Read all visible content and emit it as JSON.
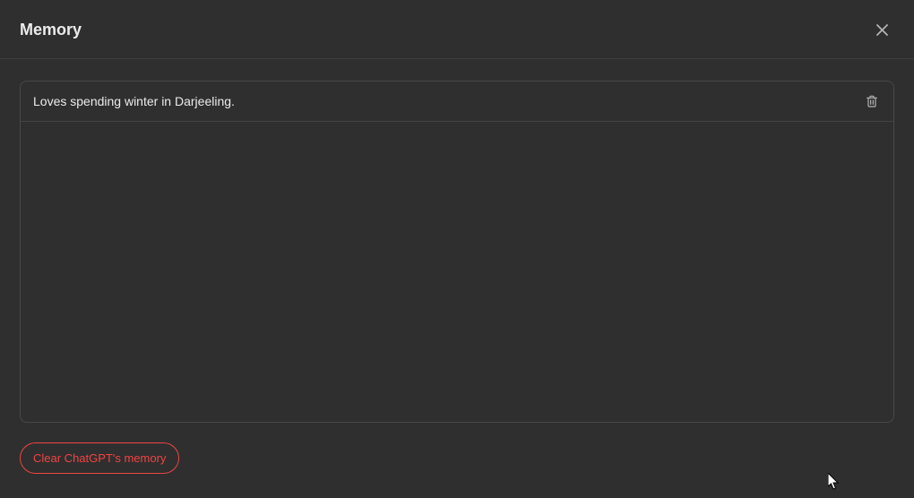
{
  "header": {
    "title": "Memory"
  },
  "memories": [
    {
      "text": "Loves spending winter in Darjeeling."
    }
  ],
  "footer": {
    "clear_label": "Clear ChatGPT's memory"
  }
}
